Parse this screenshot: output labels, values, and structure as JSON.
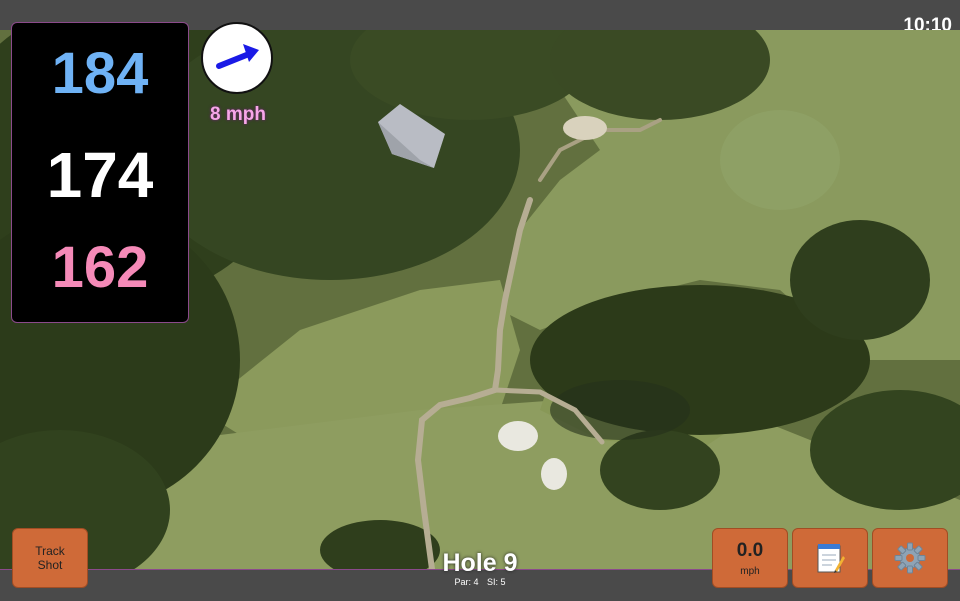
{
  "status": {
    "time": "10:10"
  },
  "distances": {
    "back": "184",
    "middle": "174",
    "front": "162"
  },
  "wind": {
    "speed_label": "8 mph",
    "arrow_icon": "wind-arrow-icon",
    "arrow_color": "#1a1ae6"
  },
  "hole": {
    "title": "Hole 9",
    "par_label": "Par: 4",
    "si_label": "SI: 5"
  },
  "controls": {
    "track_shot": {
      "line1": "Track",
      "line2": "Shot"
    },
    "speed": {
      "value": "0.0",
      "unit": "mph"
    },
    "notes_icon": "notepad-icon",
    "settings_icon": "gear-icon"
  },
  "colors": {
    "back_distance": "#6fb2f5",
    "middle_distance": "#ffffff",
    "front_distance": "#f58ab8",
    "button": "#cf6a38",
    "accent": "#8b4a8b"
  }
}
